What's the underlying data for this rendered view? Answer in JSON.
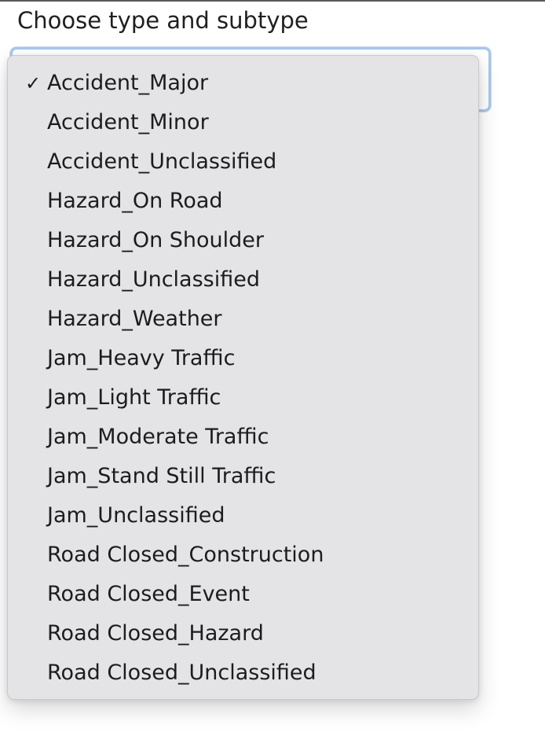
{
  "field": {
    "label": "Choose type and subtype"
  },
  "dropdown": {
    "selected_value": "Accident_Major",
    "check_glyph": "✓",
    "options": [
      {
        "label": "Accident_Major",
        "selected": true
      },
      {
        "label": "Accident_Minor",
        "selected": false
      },
      {
        "label": "Accident_Unclassified",
        "selected": false
      },
      {
        "label": "Hazard_On Road",
        "selected": false
      },
      {
        "label": "Hazard_On Shoulder",
        "selected": false
      },
      {
        "label": "Hazard_Unclassified",
        "selected": false
      },
      {
        "label": "Hazard_Weather",
        "selected": false
      },
      {
        "label": "Jam_Heavy Traffic",
        "selected": false
      },
      {
        "label": "Jam_Light Traffic",
        "selected": false
      },
      {
        "label": "Jam_Moderate Traffic",
        "selected": false
      },
      {
        "label": "Jam_Stand Still Traffic",
        "selected": false
      },
      {
        "label": "Jam_Unclassified",
        "selected": false
      },
      {
        "label": "Road Closed_Construction",
        "selected": false
      },
      {
        "label": "Road Closed_Event",
        "selected": false
      },
      {
        "label": "Road Closed_Hazard",
        "selected": false
      },
      {
        "label": "Road Closed_Unclassified",
        "selected": false
      }
    ]
  },
  "colors": {
    "focus_ring": "#a9c7ea",
    "menu_background": "#e4e3e5",
    "text": "#1c1c1e"
  }
}
